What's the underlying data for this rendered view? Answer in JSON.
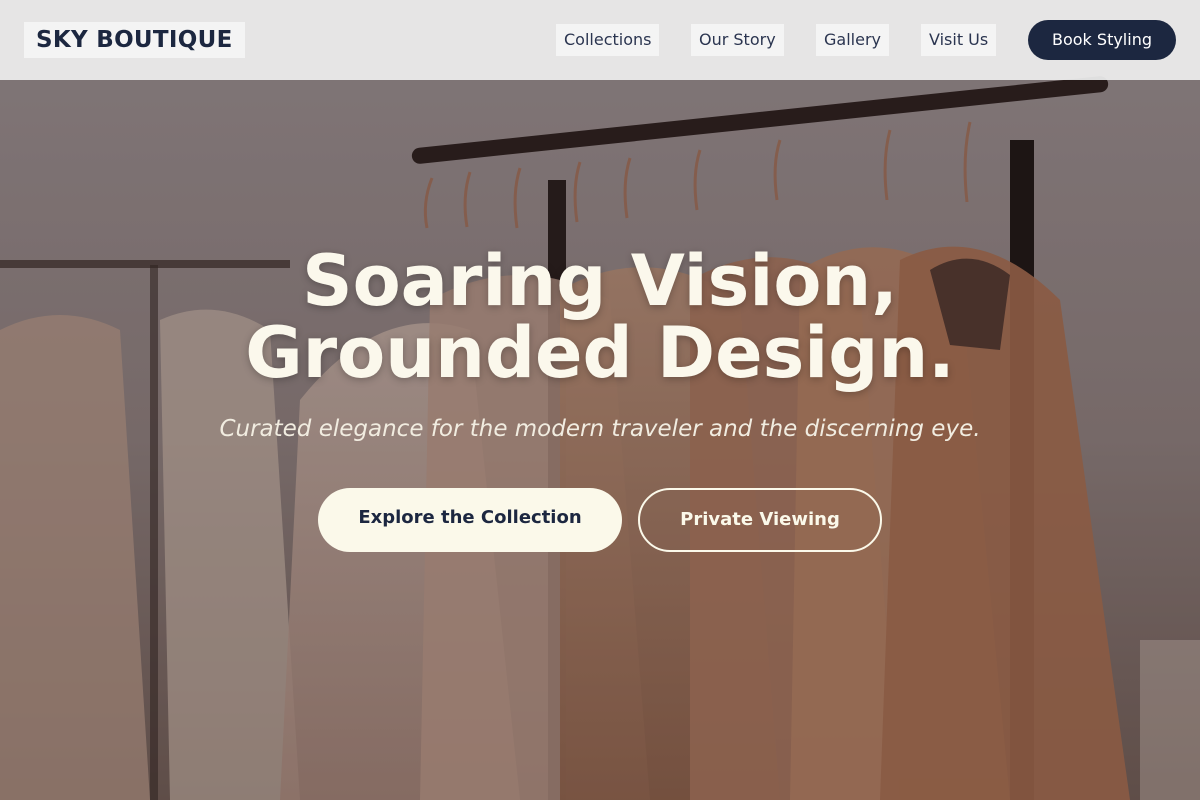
{
  "header": {
    "brand": "SKY BOUTIQUE",
    "nav": [
      {
        "label": "Collections"
      },
      {
        "label": "Our Story"
      },
      {
        "label": "Gallery"
      },
      {
        "label": "Visit Us"
      }
    ],
    "cta_label": "Book Styling"
  },
  "hero": {
    "headline_line1": "Soaring Vision,",
    "headline_line2": "Grounded Design.",
    "subheadline": "Curated elegance for the modern traveler and the discerning eye.",
    "primary_button": "Explore the Collection",
    "secondary_button": "Private Viewing",
    "background_image": "clothing-rack-photo"
  },
  "colors": {
    "brand_navy": "#1c2740",
    "cream": "#fbf9ea",
    "nav_background": "#eeeeee"
  }
}
